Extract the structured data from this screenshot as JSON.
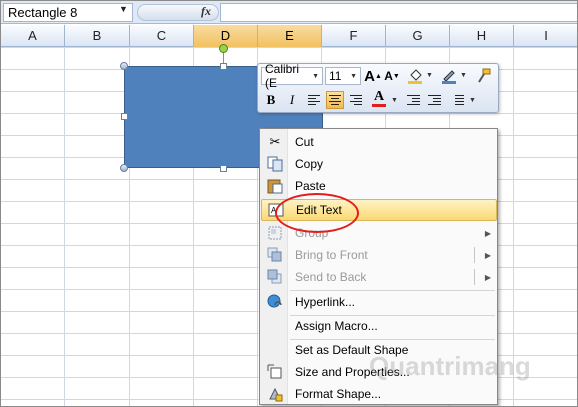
{
  "name_box": {
    "value": "Rectangle 8"
  },
  "formula_bar": {
    "fx": "fx",
    "value": ""
  },
  "columns": [
    "A",
    "B",
    "C",
    "D",
    "E",
    "F",
    "G",
    "H",
    "I"
  ],
  "selected_columns": [
    "D",
    "E"
  ],
  "mini_toolbar": {
    "font_name": "Calibri (E",
    "font_size": "11",
    "grow_font": "A",
    "shrink_font": "A",
    "bold": "B",
    "italic": "I",
    "font_color_glyph": "A",
    "active_alignment": "center"
  },
  "context_menu": {
    "items": [
      {
        "label": "Cut",
        "icon": "scissors-icon",
        "enabled": true
      },
      {
        "label": "Copy",
        "icon": "copy-icon",
        "enabled": true
      },
      {
        "label": "Paste",
        "icon": "paste-icon",
        "enabled": true
      },
      {
        "label": "Edit Text",
        "icon": "edit-text-icon",
        "enabled": true,
        "highlighted": true
      },
      {
        "label": "Group",
        "icon": "group-icon",
        "enabled": false,
        "submenu": true
      },
      {
        "label": "Bring to Front",
        "icon": "bring-to-front-icon",
        "enabled": false,
        "submenu": true
      },
      {
        "label": "Send to Back",
        "icon": "send-to-back-icon",
        "enabled": false,
        "submenu": true
      },
      {
        "label": "Hyperlink...",
        "icon": "hyperlink-icon",
        "enabled": true
      },
      {
        "label": "Assign Macro...",
        "icon": "",
        "enabled": true
      },
      {
        "label": "Set as Default Shape",
        "icon": "",
        "enabled": true
      },
      {
        "label": "Size and Properties...",
        "icon": "size-properties-icon",
        "enabled": true
      },
      {
        "label": "Format Shape...",
        "icon": "format-shape-icon",
        "enabled": true
      }
    ]
  },
  "colors": {
    "shape_fill": "#4f81bd",
    "highlight_ring": "#e11d1d",
    "font_color": "#e11d1d",
    "fill_color": "#f2c12e"
  },
  "watermark": "Quantrimang"
}
